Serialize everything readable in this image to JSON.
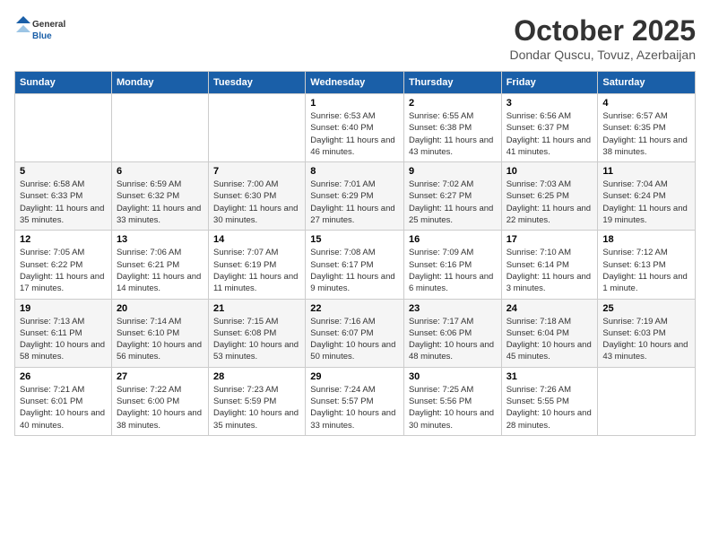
{
  "header": {
    "logo_general": "General",
    "logo_blue": "Blue",
    "month_title": "October 2025",
    "location": "Dondar Quscu, Tovuz, Azerbaijan"
  },
  "days_of_week": [
    "Sunday",
    "Monday",
    "Tuesday",
    "Wednesday",
    "Thursday",
    "Friday",
    "Saturday"
  ],
  "weeks": [
    [
      {
        "num": "",
        "info": ""
      },
      {
        "num": "",
        "info": ""
      },
      {
        "num": "",
        "info": ""
      },
      {
        "num": "1",
        "info": "Sunrise: 6:53 AM\nSunset: 6:40 PM\nDaylight: 11 hours and 46 minutes."
      },
      {
        "num": "2",
        "info": "Sunrise: 6:55 AM\nSunset: 6:38 PM\nDaylight: 11 hours and 43 minutes."
      },
      {
        "num": "3",
        "info": "Sunrise: 6:56 AM\nSunset: 6:37 PM\nDaylight: 11 hours and 41 minutes."
      },
      {
        "num": "4",
        "info": "Sunrise: 6:57 AM\nSunset: 6:35 PM\nDaylight: 11 hours and 38 minutes."
      }
    ],
    [
      {
        "num": "5",
        "info": "Sunrise: 6:58 AM\nSunset: 6:33 PM\nDaylight: 11 hours and 35 minutes."
      },
      {
        "num": "6",
        "info": "Sunrise: 6:59 AM\nSunset: 6:32 PM\nDaylight: 11 hours and 33 minutes."
      },
      {
        "num": "7",
        "info": "Sunrise: 7:00 AM\nSunset: 6:30 PM\nDaylight: 11 hours and 30 minutes."
      },
      {
        "num": "8",
        "info": "Sunrise: 7:01 AM\nSunset: 6:29 PM\nDaylight: 11 hours and 27 minutes."
      },
      {
        "num": "9",
        "info": "Sunrise: 7:02 AM\nSunset: 6:27 PM\nDaylight: 11 hours and 25 minutes."
      },
      {
        "num": "10",
        "info": "Sunrise: 7:03 AM\nSunset: 6:25 PM\nDaylight: 11 hours and 22 minutes."
      },
      {
        "num": "11",
        "info": "Sunrise: 7:04 AM\nSunset: 6:24 PM\nDaylight: 11 hours and 19 minutes."
      }
    ],
    [
      {
        "num": "12",
        "info": "Sunrise: 7:05 AM\nSunset: 6:22 PM\nDaylight: 11 hours and 17 minutes."
      },
      {
        "num": "13",
        "info": "Sunrise: 7:06 AM\nSunset: 6:21 PM\nDaylight: 11 hours and 14 minutes."
      },
      {
        "num": "14",
        "info": "Sunrise: 7:07 AM\nSunset: 6:19 PM\nDaylight: 11 hours and 11 minutes."
      },
      {
        "num": "15",
        "info": "Sunrise: 7:08 AM\nSunset: 6:17 PM\nDaylight: 11 hours and 9 minutes."
      },
      {
        "num": "16",
        "info": "Sunrise: 7:09 AM\nSunset: 6:16 PM\nDaylight: 11 hours and 6 minutes."
      },
      {
        "num": "17",
        "info": "Sunrise: 7:10 AM\nSunset: 6:14 PM\nDaylight: 11 hours and 3 minutes."
      },
      {
        "num": "18",
        "info": "Sunrise: 7:12 AM\nSunset: 6:13 PM\nDaylight: 11 hours and 1 minute."
      }
    ],
    [
      {
        "num": "19",
        "info": "Sunrise: 7:13 AM\nSunset: 6:11 PM\nDaylight: 10 hours and 58 minutes."
      },
      {
        "num": "20",
        "info": "Sunrise: 7:14 AM\nSunset: 6:10 PM\nDaylight: 10 hours and 56 minutes."
      },
      {
        "num": "21",
        "info": "Sunrise: 7:15 AM\nSunset: 6:08 PM\nDaylight: 10 hours and 53 minutes."
      },
      {
        "num": "22",
        "info": "Sunrise: 7:16 AM\nSunset: 6:07 PM\nDaylight: 10 hours and 50 minutes."
      },
      {
        "num": "23",
        "info": "Sunrise: 7:17 AM\nSunset: 6:06 PM\nDaylight: 10 hours and 48 minutes."
      },
      {
        "num": "24",
        "info": "Sunrise: 7:18 AM\nSunset: 6:04 PM\nDaylight: 10 hours and 45 minutes."
      },
      {
        "num": "25",
        "info": "Sunrise: 7:19 AM\nSunset: 6:03 PM\nDaylight: 10 hours and 43 minutes."
      }
    ],
    [
      {
        "num": "26",
        "info": "Sunrise: 7:21 AM\nSunset: 6:01 PM\nDaylight: 10 hours and 40 minutes."
      },
      {
        "num": "27",
        "info": "Sunrise: 7:22 AM\nSunset: 6:00 PM\nDaylight: 10 hours and 38 minutes."
      },
      {
        "num": "28",
        "info": "Sunrise: 7:23 AM\nSunset: 5:59 PM\nDaylight: 10 hours and 35 minutes."
      },
      {
        "num": "29",
        "info": "Sunrise: 7:24 AM\nSunset: 5:57 PM\nDaylight: 10 hours and 33 minutes."
      },
      {
        "num": "30",
        "info": "Sunrise: 7:25 AM\nSunset: 5:56 PM\nDaylight: 10 hours and 30 minutes."
      },
      {
        "num": "31",
        "info": "Sunrise: 7:26 AM\nSunset: 5:55 PM\nDaylight: 10 hours and 28 minutes."
      },
      {
        "num": "",
        "info": ""
      }
    ]
  ]
}
